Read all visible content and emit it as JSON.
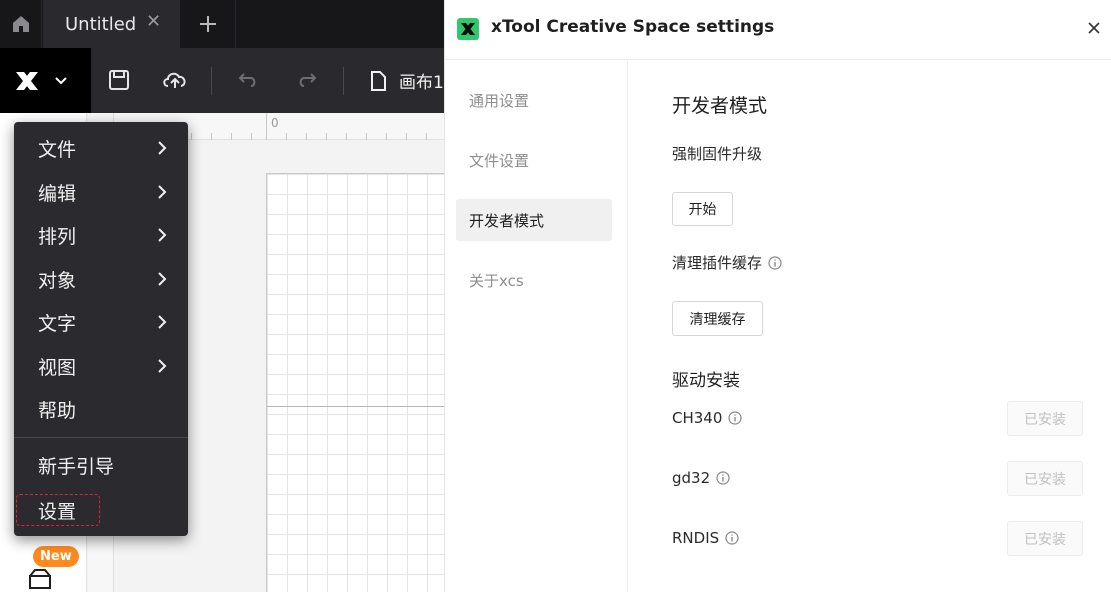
{
  "tabs": {
    "active_title": "Untitled"
  },
  "toolbar": {
    "canvas_name": "画布1"
  },
  "ruler": {
    "zero_label": "0"
  },
  "rail": {
    "new_badge": "New"
  },
  "menu": {
    "items": [
      {
        "label": "文件"
      },
      {
        "label": "编辑"
      },
      {
        "label": "排列"
      },
      {
        "label": "对象"
      },
      {
        "label": "文字"
      },
      {
        "label": "视图"
      },
      {
        "label": "帮助"
      },
      {
        "label": "新手引导"
      },
      {
        "label": "设置"
      }
    ]
  },
  "dialog": {
    "title": "xTool Creative Space settings",
    "nav": [
      {
        "label": "通用设置"
      },
      {
        "label": "文件设置"
      },
      {
        "label": "开发者模式"
      },
      {
        "label": "关于xcs"
      }
    ],
    "section_title": "开发者模式",
    "force_firmware_label": "强制固件升级",
    "force_firmware_button": "开始",
    "clear_cache_label": "清理插件缓存",
    "clear_cache_button": "清理缓存",
    "driver_title": "驱动安装",
    "drivers": [
      {
        "name": "CH340",
        "status": "已安装"
      },
      {
        "name": "gd32",
        "status": "已安装"
      },
      {
        "name": "RNDIS",
        "status": "已安装"
      }
    ]
  },
  "colors": {
    "accent": "#32c76d",
    "badge": "#ff8a1f",
    "highlight": "#e0223a"
  }
}
